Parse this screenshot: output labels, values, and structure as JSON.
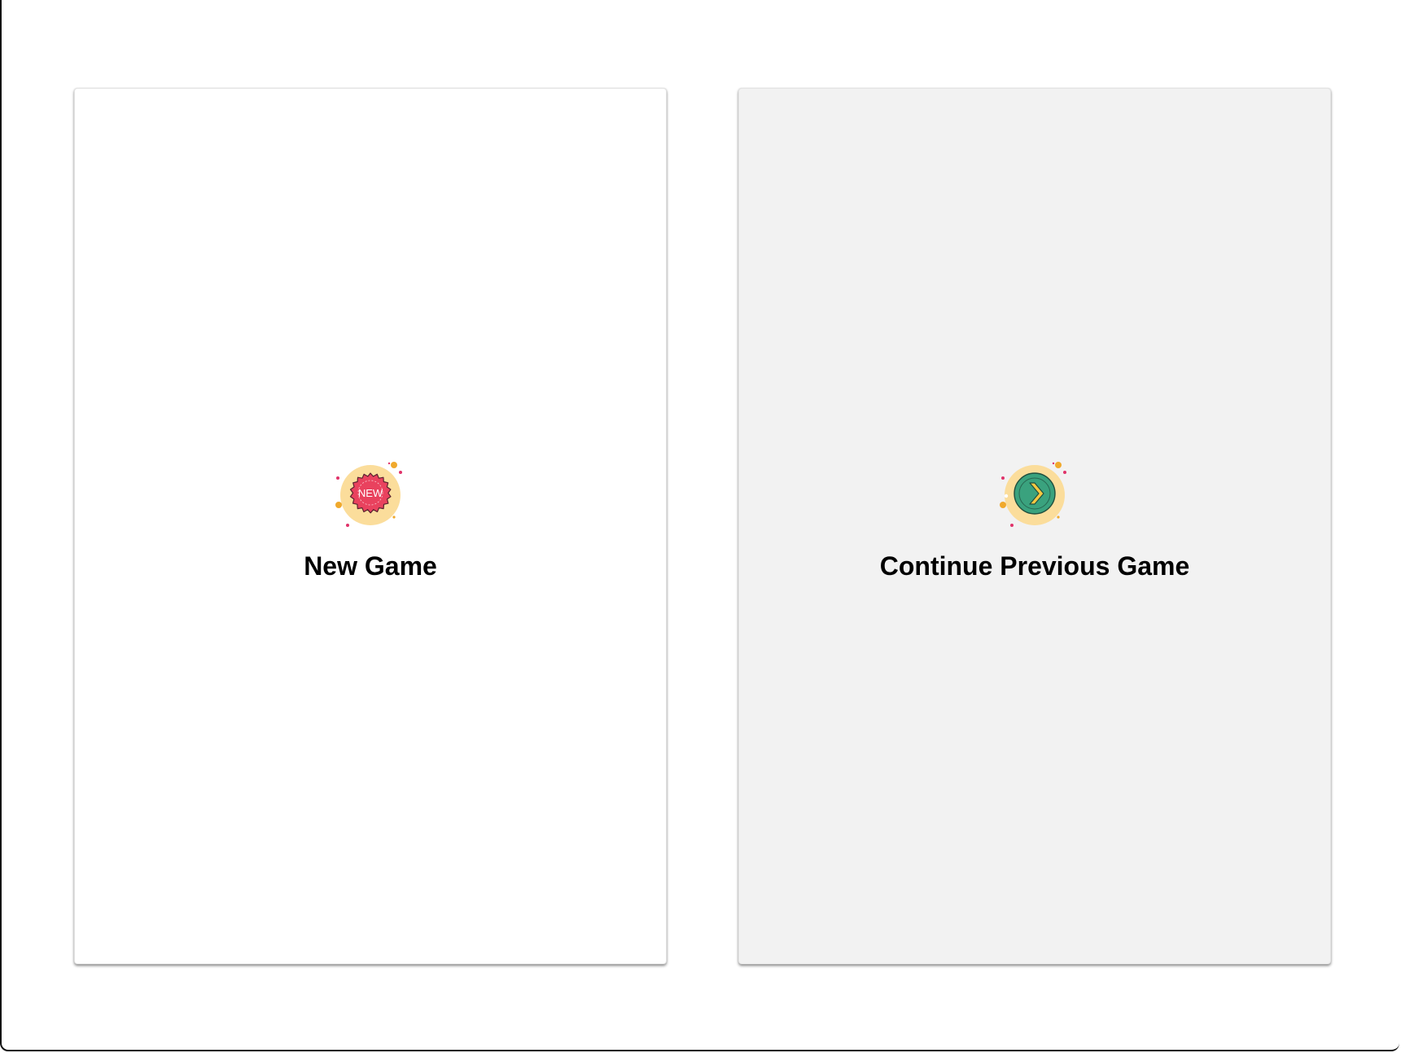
{
  "cards": [
    {
      "id": "new-game",
      "label": "New Game",
      "icon": "new-badge-icon",
      "icon_text": "NEW",
      "background": "#ffffff"
    },
    {
      "id": "continue-game",
      "label": "Continue Previous Game",
      "icon": "continue-arrow-icon",
      "background": "#f2f2f2"
    }
  ],
  "colors": {
    "icon_halo": "#fbdd9b",
    "badge_red": "#e9425e",
    "badge_outline": "#5a2230",
    "coin_green": "#3aa27e",
    "arrow_yellow": "#f5c842",
    "dot_orange": "#f0a92c",
    "dot_pink": "#e0336a"
  }
}
